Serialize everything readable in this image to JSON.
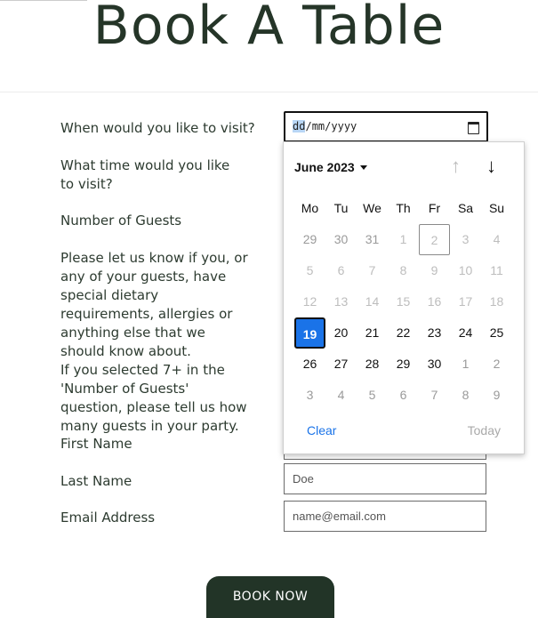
{
  "header": {
    "title": "Book A Table"
  },
  "form": {
    "visit_date_label": "When would you like to visit?",
    "visit_date_value": {
      "day": "dd",
      "sep": "/",
      "month": "mm",
      "year": "yyyy"
    },
    "time_label": "What time would you like to visit?",
    "guests_label": "Number of Guests",
    "requirements_label_1": "Please let us know if you, or any of your guests, have special dietary requirements, allergies or anything else that we should know about.",
    "requirements_label_2": "If you selected 7+ in the 'Number of Guests' question, please tell us how many guests in your party.",
    "first_name_label": "First Name",
    "last_name_label": "Last Name",
    "last_name_placeholder": "Doe",
    "email_label": "Email Address",
    "email_placeholder": "name@email.com",
    "submit_label": "BOOK NOW"
  },
  "calendar": {
    "month_label": "June 2023",
    "weekdays": [
      "Mo",
      "Tu",
      "We",
      "Th",
      "Fr",
      "Sa",
      "Su"
    ],
    "weeks": [
      [
        "29",
        "30",
        "31",
        "1",
        "2",
        "3",
        "4"
      ],
      [
        "5",
        "6",
        "7",
        "8",
        "9",
        "10",
        "11"
      ],
      [
        "12",
        "13",
        "14",
        "15",
        "16",
        "17",
        "18"
      ],
      [
        "19",
        "20",
        "21",
        "22",
        "23",
        "24",
        "25"
      ],
      [
        "26",
        "27",
        "28",
        "29",
        "30",
        "1",
        "2"
      ],
      [
        "3",
        "4",
        "5",
        "6",
        "7",
        "8",
        "9"
      ]
    ],
    "selected_day": "19",
    "today_day": "2",
    "clear_label": "Clear",
    "today_label": "Today",
    "colors": {
      "accent": "#1a73e8",
      "button": "#223427"
    }
  }
}
